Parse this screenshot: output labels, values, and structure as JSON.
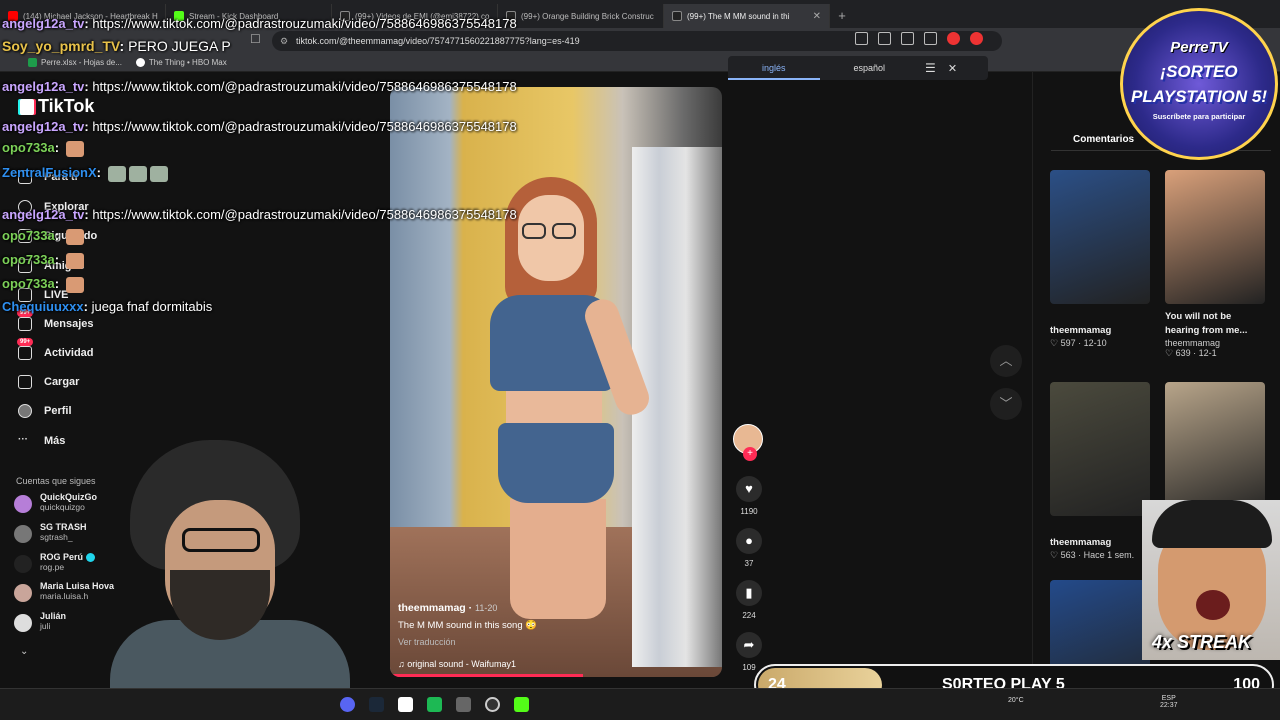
{
  "browser": {
    "tabs": [
      {
        "label": "(144) Michael Jackson - Heartbreak H"
      },
      {
        "label": "Stream - Kick Dashboard"
      },
      {
        "label": "(99+) Videos de EMI (@emi38722) co"
      },
      {
        "label": "(99+) Orange Building Brick Construc"
      },
      {
        "label": "(99+) The M MM sound in thi"
      }
    ],
    "url": "tiktok.com/@theemmamag/video/7574771560221887775?lang=es-419",
    "bookmarks": [
      {
        "label": "Perre.xlsx - Hojas de..."
      },
      {
        "label": "The Thing • HBO Max"
      }
    ]
  },
  "translate": {
    "languages": [
      "inglés",
      "español"
    ]
  },
  "tiktok": {
    "logo": "TikTok",
    "nav": [
      {
        "label": "Para ti"
      },
      {
        "label": "Explorar"
      },
      {
        "label": "Siguiendo"
      },
      {
        "label": "Amigos"
      },
      {
        "label": "LIVE"
      },
      {
        "label": "Mensajes",
        "badge": "99+"
      },
      {
        "label": "Actividad",
        "badge": "99+"
      },
      {
        "label": "Cargar"
      },
      {
        "label": "Perfil"
      },
      {
        "label": "Más"
      }
    ],
    "following_title": "Cuentas que sigues",
    "following": [
      {
        "name": "QuickQuizGo",
        "handle": "quickquizgo"
      },
      {
        "name": "SG TRASH",
        "handle": "sgtrash_"
      },
      {
        "name": "ROG Perú",
        "handle": "rog.pe"
      },
      {
        "name": "Maria Luisa Hova",
        "handle": "maria.luisa.h"
      },
      {
        "name": "Julián",
        "handle": "juli"
      }
    ],
    "video": {
      "author": "theemmamag",
      "date": "11-20",
      "description": "The M MM sound in this song 😳",
      "translate": "Ver traducción",
      "music": "original sound - Waifumay1",
      "progress": 0.58
    },
    "actions": {
      "likes": "1190",
      "comments": "37",
      "saves": "224",
      "shares": "109"
    },
    "comments_tab": "Comentarios",
    "thumbs": [
      {
        "title": "",
        "author": "theemmamag",
        "stats": "♡ 597 · 12-10",
        "color": "#2b4f86"
      },
      {
        "title": "You will not be hearing from me...",
        "author": "theemmamag",
        "stats": "♡ 639 · 12-1",
        "color": "#d9a07a"
      },
      {
        "title": "",
        "author": "theemmamag",
        "stats": "♡ 563 · Hace 1 sem.",
        "color": "#4b4a3d"
      },
      {
        "title": "",
        "author": "",
        "stats": "",
        "color": "#b8a58a"
      },
      {
        "title": "",
        "author": "",
        "stats": "",
        "color": "#234a8a"
      }
    ]
  },
  "chat": [
    {
      "user": "angelg12a_tv",
      "msg": "https://www.tiktok.com/@padrastrouzumaki/video/7588646986375548178",
      "color": "#c9a6ff"
    },
    {
      "user": "Soy_yo_pmrd_TV",
      "msg": "PERO JUEGA P",
      "color": "#e8c24a"
    },
    {
      "user": "angelg12a_tv",
      "msg": "https://www.tiktok.com/@padrastrouzumaki/video/7588646986375548178",
      "color": "#c9a6ff"
    },
    {
      "user": "angelg12a_tv",
      "msg": "https://www.tiktok.com/@padrastrouzumaki/video/7588646986375548178",
      "color": "#c9a6ff"
    },
    {
      "user": "opo733a",
      "msg": "",
      "color": "#7cd158"
    },
    {
      "user": "ZentralFusionX",
      "msg": "",
      "color": "#2e8ff0"
    },
    {
      "user": "angelg12a_tv",
      "msg": "https://www.tiktok.com/@padrastrouzumaki/video/7588646986375548178",
      "color": "#c9a6ff"
    },
    {
      "user": "opo733a",
      "msg": "",
      "color": "#7cd158"
    },
    {
      "user": "opo733a",
      "msg": "",
      "color": "#7cd158"
    },
    {
      "user": "opo733a",
      "msg": "",
      "color": "#7cd158"
    },
    {
      "user": "Chequiuuxxx",
      "msg": "juega fnaf dormitabis",
      "color": "#2e8ff0"
    }
  ],
  "promo": {
    "brand": "PerreTV",
    "title_1": "¡SORTEO",
    "title_2": "PLAYSTATION 5!",
    "sub": "Suscríbete para participar"
  },
  "streak": "4x STREAK",
  "goal": {
    "current": "24",
    "title": "S0RTEO PLAY 5",
    "max": "100",
    "fraction": 0.24
  },
  "taskbar": {
    "weather": "20°C",
    "lang": "ESP",
    "time": "22:37"
  },
  "colors": {
    "tiktok_red": "#fe2c55",
    "tiktok_cyan": "#25f4ee",
    "link_blue": "#8ab4f8"
  }
}
